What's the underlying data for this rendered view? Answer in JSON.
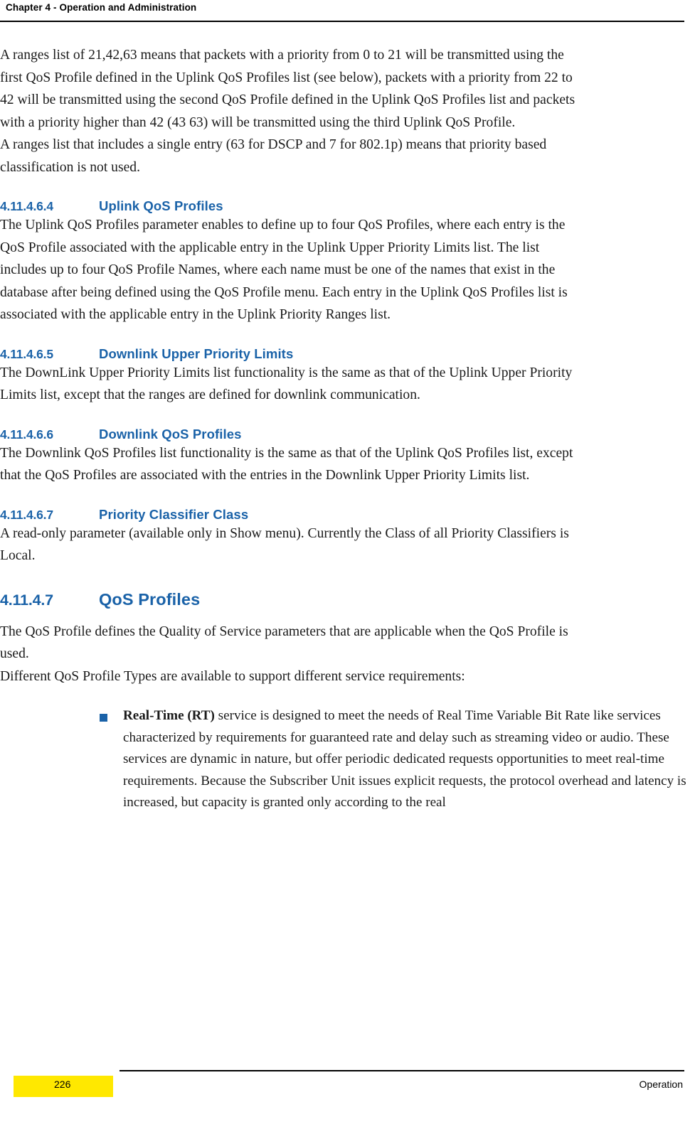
{
  "header": {
    "chapter": "Chapter 4 - Operation and Administration"
  },
  "content": {
    "intro_paragraphs": [
      "A ranges list of 21,42,63 means that packets with a priority from 0 to 21 will be transmitted using the first QoS Profile defined in the Uplink QoS Profiles list (see below), packets with a priority from 22 to 42 will be transmitted using the second QoS Profile defined in the Uplink QoS Profiles list and packets with a priority higher than 42 (43 63) will be transmitted using the third Uplink QoS Profile.",
      "A ranges list that includes a single entry (63 for DSCP and 7 for 802.1p) means that priority based classification is not used."
    ],
    "sections": [
      {
        "number": "4.11.4.6.4",
        "title": "Uplink QoS Profiles",
        "body": "The Uplink QoS Profiles parameter enables to define up to four QoS Profiles, where each entry is the QoS Profile associated with the applicable entry in the Uplink Upper Priority Limits list. The list includes up to four QoS Profile Names, where each name must be one of the names that exist in the database after being defined using the QoS Profile menu. Each entry in the Uplink QoS Profiles list is associated with the applicable entry in the Uplink Priority Ranges list."
      },
      {
        "number": "4.11.4.6.5",
        "title": "Downlink Upper Priority Limits",
        "body": "The DownLink Upper Priority Limits list functionality is the same as that of the Uplink Upper Priority Limits list, except that the ranges are defined for downlink communication."
      },
      {
        "number": "4.11.4.6.6",
        "title": "Downlink QoS Profiles",
        "body": "The Downlink QoS Profiles list functionality is the same as that of the Uplink QoS Profiles list, except that the QoS Profiles are associated with the entries in the Downlink Upper Priority Limits list."
      },
      {
        "number": "4.11.4.6.7",
        "title": "Priority Classifier Class",
        "body": "A read-only parameter (available only in Show menu). Currently the Class of all Priority Classifiers is Local."
      }
    ],
    "main_section": {
      "number": "4.11.4.7",
      "title": "QoS Profiles",
      "paragraphs": [
        "The QoS Profile defines the Quality of Service parameters that are applicable when the QoS Profile is used.",
        "Different QoS Profile Types are available to support different service requirements:"
      ]
    },
    "bullets": [
      {
        "lead": "Real-Time (RT)",
        "text": " service is designed to meet the needs of Real Time Variable Bit Rate like services characterized by requirements for guaranteed rate and delay such as streaming video or audio. These services are dynamic in nature, but offer periodic dedicated requests opportunities to meet real-time requirements. Because the Subscriber Unit issues explicit requests, the protocol overhead and latency is increased, but capacity is granted only according to the real"
      }
    ]
  },
  "footer": {
    "page_number": "226",
    "section_label": "Operation"
  },
  "colors": {
    "heading_blue": "#1a62a8",
    "tab_yellow": "#ffe800"
  }
}
